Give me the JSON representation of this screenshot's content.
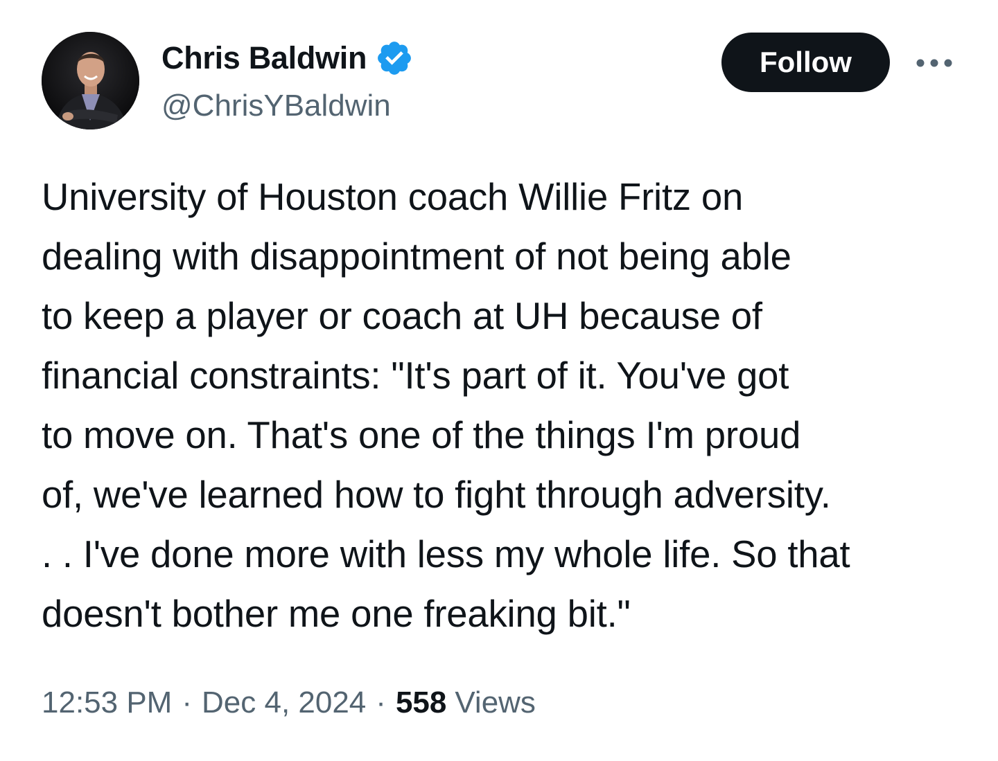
{
  "author": {
    "display_name": "Chris Baldwin",
    "handle": "@ChrisYBaldwin",
    "verified": true,
    "verified_color": "#1d9bf0",
    "avatar_icon": "profile-photo"
  },
  "actions": {
    "follow_label": "Follow",
    "more_icon": "ellipsis-icon"
  },
  "tweet": {
    "text": "University of Houston coach Willie Fritz on\ndealing with disappointment of not being able\nto keep a player or coach at UH because of\nfinancial constraints: \"It's part of it. You've got\nto move on. That's one of the things I'm proud\nof, we've learned how to fight through adversity.\n. . I've done more with less my whole life. So that\ndoesn't bother me one freaking bit.\""
  },
  "meta": {
    "time": "12:53 PM",
    "separator": "·",
    "date": "Dec 4, 2024",
    "views_count": "558",
    "views_label": "Views"
  },
  "colors": {
    "text_primary": "#0f1419",
    "text_secondary": "#536471",
    "follow_bg": "#0f1419",
    "background": "#ffffff"
  }
}
